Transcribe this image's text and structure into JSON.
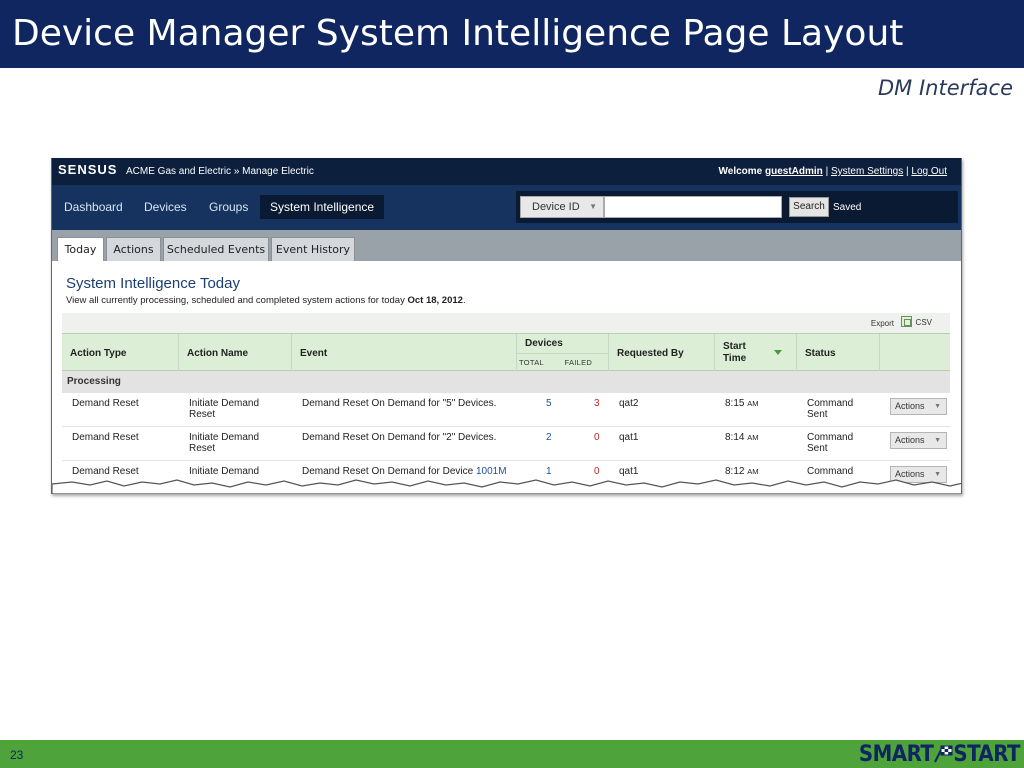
{
  "slide": {
    "title": "Device Manager System Intelligence Page Layout",
    "subtitle": "DM Interface",
    "page_number": "23",
    "footer_logo_left": "SMART",
    "footer_logo_right": "START"
  },
  "app": {
    "brand": "sensus",
    "breadcrumb": "ACME Gas and Electric » Manage Electric",
    "welcome_label": "Welcome",
    "username": "guestAdmin",
    "separator": "|",
    "system_settings": "System Settings",
    "log_out": "Log Out"
  },
  "nav": {
    "items": [
      {
        "label": "Dashboard"
      },
      {
        "label": "Devices"
      },
      {
        "label": "Groups"
      },
      {
        "label": "System Intelligence"
      }
    ],
    "active": "System Intelligence"
  },
  "search": {
    "type_selected": "Device ID",
    "input_value": "",
    "button_label": "Search",
    "saved_label": "Saved"
  },
  "tabs": [
    {
      "label": "Today"
    },
    {
      "label": "Actions"
    },
    {
      "label": "Scheduled Events"
    },
    {
      "label": "Event History"
    }
  ],
  "content": {
    "title": "System Intelligence Today",
    "description": "View all currently processing, scheduled and completed system actions for today",
    "date": "Oct 18, 2012",
    "date_suffix": ".",
    "export_label": "Export",
    "csv_label": "CSV"
  },
  "table": {
    "headers": {
      "action_type": "Action Type",
      "action_name": "Action Name",
      "event": "Event",
      "devices": "Devices",
      "total": "TOTAL",
      "failed": "FAILED",
      "requested_by": "Requested By",
      "start_time_line1": "Start",
      "start_time_line2": "Time",
      "status": "Status"
    },
    "group_label": "Processing",
    "rows": [
      {
        "action_type": "Demand Reset",
        "action_name_1": "Initiate Demand",
        "action_name_2": "Reset",
        "event": "Demand Reset On Demand for \"5\" Devices.",
        "total": "5",
        "failed": "3",
        "requested_by": "qat2",
        "time": "8:15",
        "ampm": "AM",
        "status_1": "Command",
        "status_2": "Sent",
        "actions_label": "Actions"
      },
      {
        "action_type": "Demand Reset",
        "action_name_1": "Initiate Demand",
        "action_name_2": "Reset",
        "event": "Demand Reset On Demand for \"2\" Devices.",
        "total": "2",
        "failed": "0",
        "requested_by": "qat1",
        "time": "8:14",
        "ampm": "AM",
        "status_1": "Command",
        "status_2": "Sent",
        "actions_label": "Actions"
      },
      {
        "action_type": "Demand Reset",
        "action_name_1": "Initiate Demand",
        "action_name_2": "",
        "event": "Demand Reset On Demand for Device",
        "event_link": "1001M",
        "total": "1",
        "failed": "0",
        "requested_by": "qat1",
        "time": "8:12",
        "ampm": "AM",
        "status_1": "Command",
        "status_2": "",
        "actions_label": "Actions"
      }
    ]
  },
  "colors": {
    "title_bar": "#0f2660",
    "footer": "#4ea33a",
    "app_topbar": "#0c1f3d",
    "app_navbar": "#15335e",
    "table_header": "#dcefd6",
    "failed_count": "#c0272d"
  }
}
